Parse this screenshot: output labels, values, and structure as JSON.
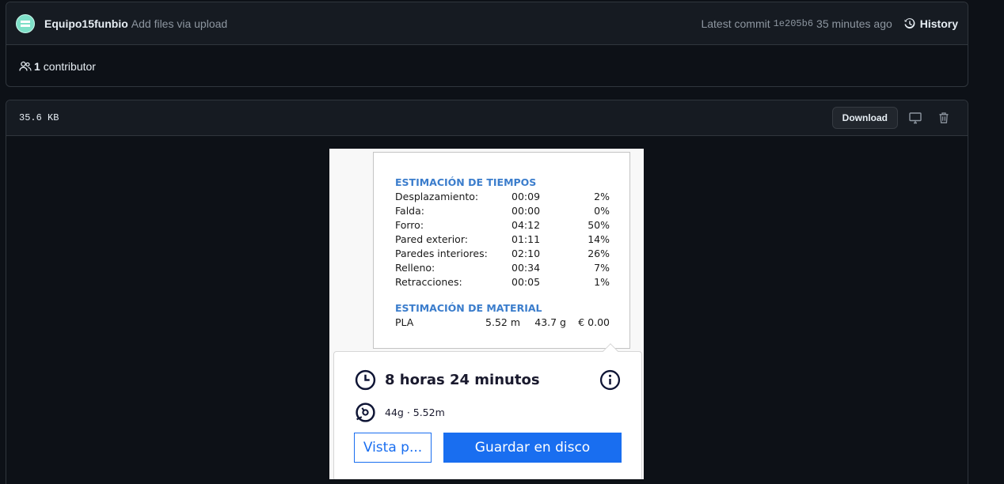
{
  "commit": {
    "author": "Equipo15funbio",
    "message": "Add files via upload",
    "latest_label": "Latest commit",
    "sha": "1e205b6",
    "time_ago": "35 minutes ago",
    "history_label": "History"
  },
  "contributors": {
    "count": "1",
    "label": "contributor"
  },
  "file": {
    "size": "35.6 KB",
    "download_label": "Download"
  },
  "preview": {
    "time_section_title": "ESTIMACIÓN DE TIEMPOS",
    "time_rows": [
      {
        "name": "Desplazamiento:",
        "time": "00:09",
        "pct": "2%"
      },
      {
        "name": "Falda:",
        "time": "00:00",
        "pct": "0%"
      },
      {
        "name": "Forro:",
        "time": "04:12",
        "pct": "50%"
      },
      {
        "name": "Pared exterior:",
        "time": "01:11",
        "pct": "14%"
      },
      {
        "name": "Paredes interiores:",
        "time": "02:10",
        "pct": "26%"
      },
      {
        "name": "Relleno:",
        "time": "00:34",
        "pct": "7%"
      },
      {
        "name": "Retracciones:",
        "time": "00:05",
        "pct": "1%"
      }
    ],
    "material_section_title": "ESTIMACIÓN DE MATERIAL",
    "material": {
      "name": "PLA",
      "length": "5.52 m",
      "weight": "43.7 g",
      "cost": "€ 0.00"
    },
    "print_time": "8 horas 24 minutos",
    "material_summary": "44g · 5.52m",
    "preview_button": "Vista p...",
    "save_button": "Guardar en disco",
    "accent_color": "#196ef0",
    "title_color": "#3b7dcc"
  },
  "icons": [
    "history-icon",
    "people-icon",
    "desktop-icon",
    "trash-icon",
    "clock-icon",
    "info-icon",
    "spool-icon"
  ]
}
